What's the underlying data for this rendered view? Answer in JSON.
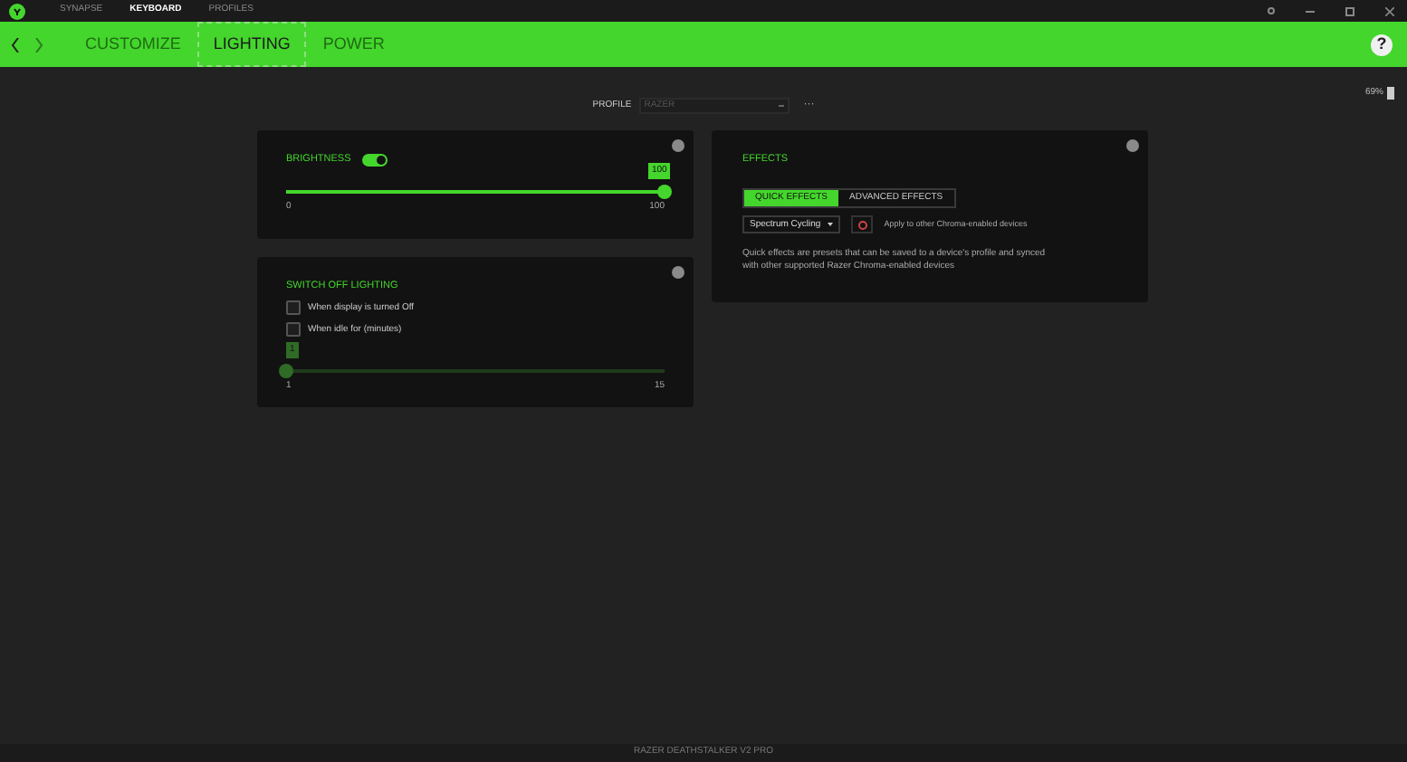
{
  "top_nav": [
    {
      "label": "SYNAPSE",
      "selected": false
    },
    {
      "label": "KEYBOARD",
      "selected": true
    },
    {
      "label": "PROFILES",
      "selected": false
    }
  ],
  "tabs": [
    {
      "label": "CUSTOMIZE",
      "selected": false
    },
    {
      "label": "LIGHTING",
      "selected": true
    },
    {
      "label": "POWER",
      "selected": false
    }
  ],
  "help": "?",
  "profile": {
    "label": "PROFILE",
    "value": "RAZER",
    "more": "···"
  },
  "battery": "69%",
  "brightness": {
    "title": "BRIGHTNESS",
    "on": true,
    "level": 1,
    "reading": "100",
    "min": "0",
    "max": "100"
  },
  "switch_off": {
    "title": "SWITCH OFF LIGHTING",
    "options": [
      {
        "label": "When display is turned Off",
        "checked": false
      },
      {
        "label": "When idle for (minutes)",
        "checked": false
      }
    ],
    "disabled": true,
    "level": 0,
    "reading": "1",
    "min": "1",
    "max": "15"
  },
  "effects": {
    "title": "EFFECTS",
    "tabs": [
      {
        "label": "QUICK EFFECTS",
        "selected": true
      },
      {
        "label": "ADVANCED EFFECTS",
        "selected": false
      }
    ],
    "effect": "Spectrum Cycling",
    "apply_label": "Apply to other Chroma-enabled devices",
    "description": "Quick effects are presets that can be saved to a device's profile and synced with other supported Razer Chroma-enabled devices"
  },
  "status_bar": "RAZER DEATHSTALKER V2 PRO"
}
